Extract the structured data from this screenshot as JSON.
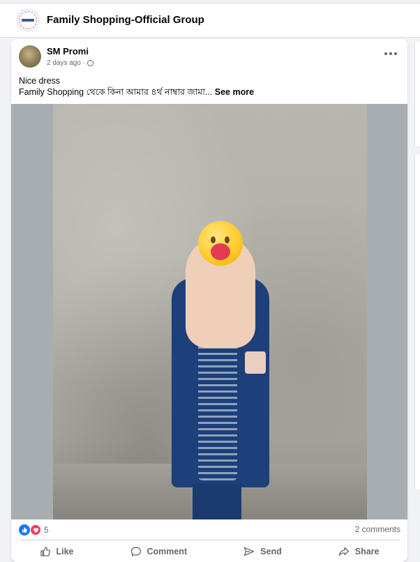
{
  "group": {
    "title": "Family Shopping-Official Group"
  },
  "post": {
    "author": "SM Promi",
    "time": "2 days ago",
    "caption_line1": "Nice dress",
    "caption_line2": "Family Shopping থেকে কিনা আমার ৪র্থ নাম্বার জামা...",
    "see_more": "See more",
    "reaction_count": "5",
    "comments": "2 comments"
  },
  "actions": {
    "like": "Like",
    "comment": "Comment",
    "send": "Send",
    "share": "Share"
  },
  "icons": {
    "more": "more-horizontal-icon",
    "audience": "globe-icon",
    "like": "thumbs-up-icon",
    "comment": "speech-bubble-icon",
    "send": "paper-plane-icon",
    "share": "share-arrow-icon"
  },
  "colors": {
    "facebook_blue": "#1877f2",
    "love_red": "#f33e58",
    "muted_text": "#65676b"
  }
}
